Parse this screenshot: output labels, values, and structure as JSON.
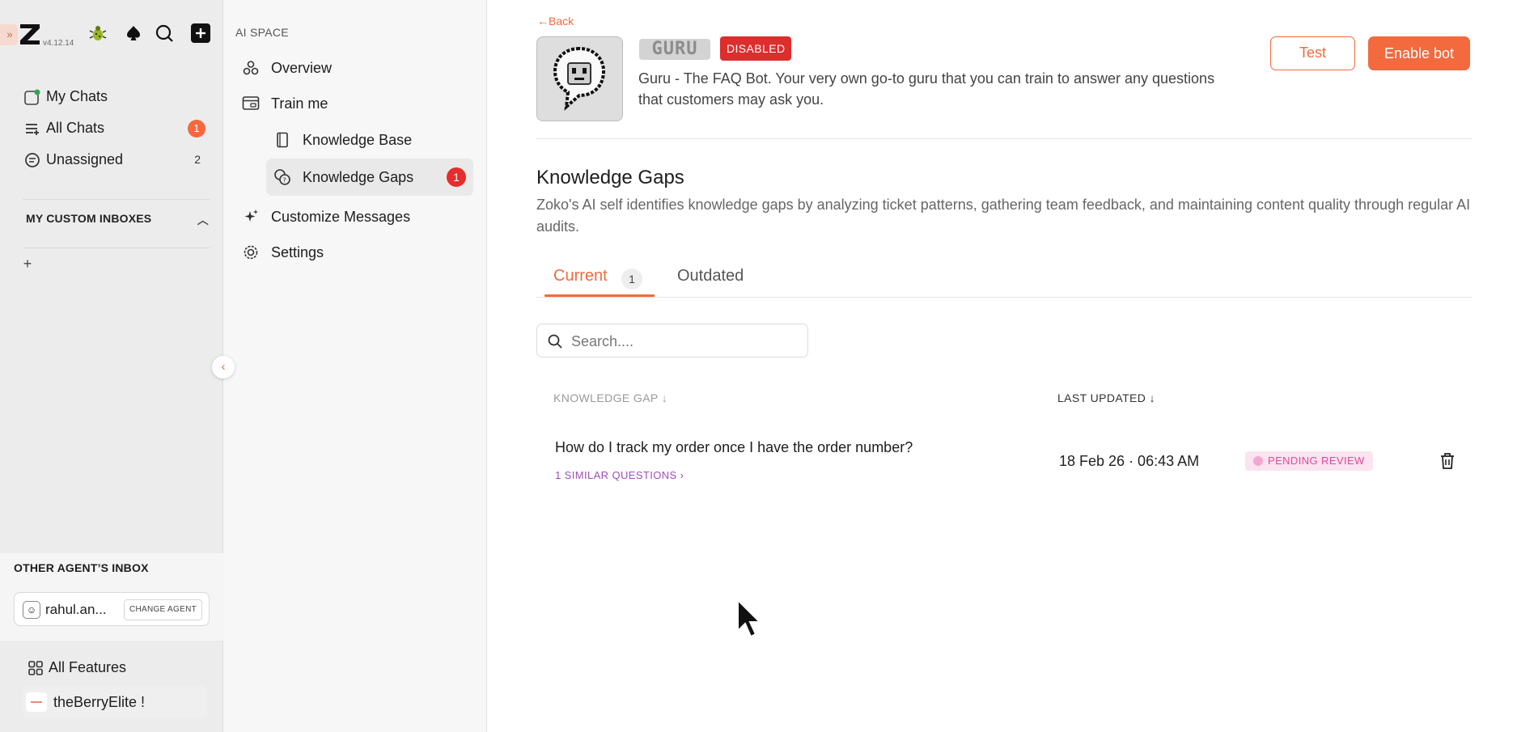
{
  "app": {
    "version": "v4.12.14",
    "brand_color": "#f26a3d",
    "expand_label": "»"
  },
  "rail": {
    "nav": [
      {
        "label": "My Chats",
        "icon": "my-chats-icon"
      },
      {
        "label": "All Chats",
        "icon": "all-chats-icon",
        "badge": "1"
      },
      {
        "label": "Unassigned",
        "icon": "unassigned-icon",
        "count": "2"
      }
    ],
    "custom_inboxes_title": "MY CUSTOM INBOXES",
    "add_inbox_label": "+",
    "other_agent": {
      "title": "OTHER AGENT’S INBOX",
      "agent_name": "rahul.an...",
      "change_label": "CHANGE AGENT"
    },
    "all_features_label": "All Features",
    "store_name": "theBerryElite !"
  },
  "panel": {
    "title": "AI SPACE",
    "items": [
      {
        "label": "Overview",
        "icon": "overview-icon"
      },
      {
        "label": "Train me",
        "icon": "train-me-icon"
      },
      {
        "label": "Knowledge Base",
        "icon": "book-icon"
      },
      {
        "label": "Knowledge Gaps",
        "icon": "knowledge-gaps-icon",
        "badge": "1",
        "active": true
      },
      {
        "label": "Customize Messages",
        "icon": "sparkle-icon"
      },
      {
        "label": "Settings",
        "icon": "gear-icon"
      }
    ]
  },
  "main": {
    "back_label": "←Back",
    "bot": {
      "name": "GURU",
      "status": "DISABLED",
      "description": "Guru - The FAQ Bot. Your very own go-to guru that you can train to answer any questions that customers may ask you."
    },
    "test_label": "Test",
    "enable_label": "Enable bot",
    "section_title": "Knowledge Gaps",
    "section_desc": "Zoko's AI self identifies knowledge gaps by analyzing ticket patterns, gathering team feedback, and maintaining content quality through regular AI audits.",
    "tabs": [
      {
        "label": "Current",
        "count": "1",
        "active": true
      },
      {
        "label": "Outdated"
      }
    ],
    "search_placeholder": "Search....",
    "table": {
      "columns": [
        "KNOWLEDGE GAP ↓",
        "LAST UPDATED ↓"
      ],
      "rows": [
        {
          "question": "How do I track my order once I have the order number?",
          "similar": "1 SIMILAR QUESTIONS",
          "last_updated": "18 Feb 26 · 06:43 AM",
          "status": "PENDING REVIEW"
        }
      ]
    }
  }
}
